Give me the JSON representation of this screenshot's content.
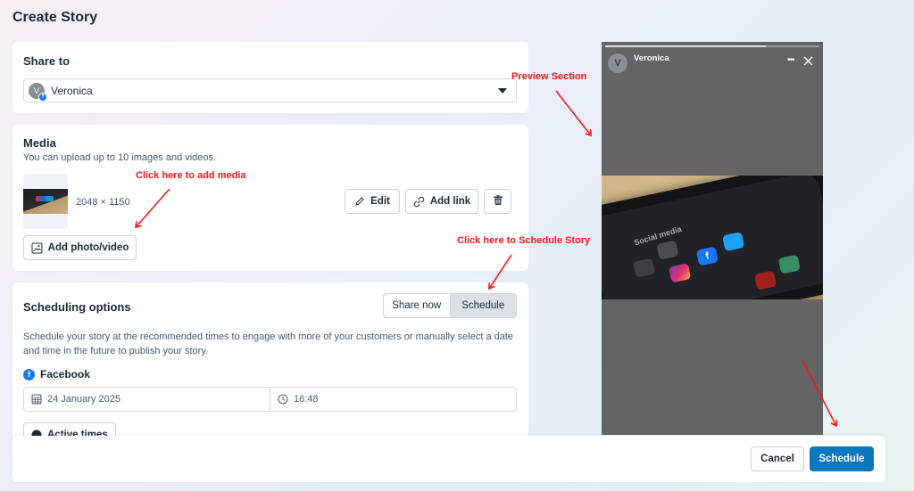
{
  "page": {
    "title": "Create Story"
  },
  "share_to": {
    "title": "Share to",
    "selected_account": "Veronica",
    "avatar_initial": "V",
    "icons": {
      "platform_badge": "facebook-icon",
      "dropdown": "caret-down-icon"
    }
  },
  "media": {
    "title": "Media",
    "subtitle": "You can upload up to 10 images and videos.",
    "items": [
      {
        "dimensions": "2048 × 1150"
      }
    ],
    "buttons": {
      "edit": "Edit",
      "add_link": "Add link",
      "delete_icon": "trash-icon",
      "add_photo_video": "Add photo/video"
    }
  },
  "scheduling": {
    "title": "Scheduling options",
    "tabs": [
      {
        "label": "Share now",
        "active": false
      },
      {
        "label": "Schedule",
        "active": true
      }
    ],
    "description": "Schedule your story at the recommended times to engage with more of your customers or manually select a date and time in the future to publish your story.",
    "platform": "Facebook",
    "date": "24 January 2025",
    "time": "16:48",
    "active_times_label": "Active times"
  },
  "footer": {
    "cancel": "Cancel",
    "schedule": "Schedule"
  },
  "preview": {
    "account_name": "Veronica",
    "avatar_initial": "V",
    "progress": 0.75,
    "more_glyph": "•••",
    "image_label": "Social media"
  },
  "annotations": {
    "preview": "Preview Section",
    "media": "Click here to add media",
    "schedule": "Click here to Schedule Story"
  },
  "colors": {
    "primary_button": "#0a78be",
    "facebook_blue": "#1877f2",
    "annotation_red": "#f01a1a",
    "preview_bg": "#646464"
  }
}
